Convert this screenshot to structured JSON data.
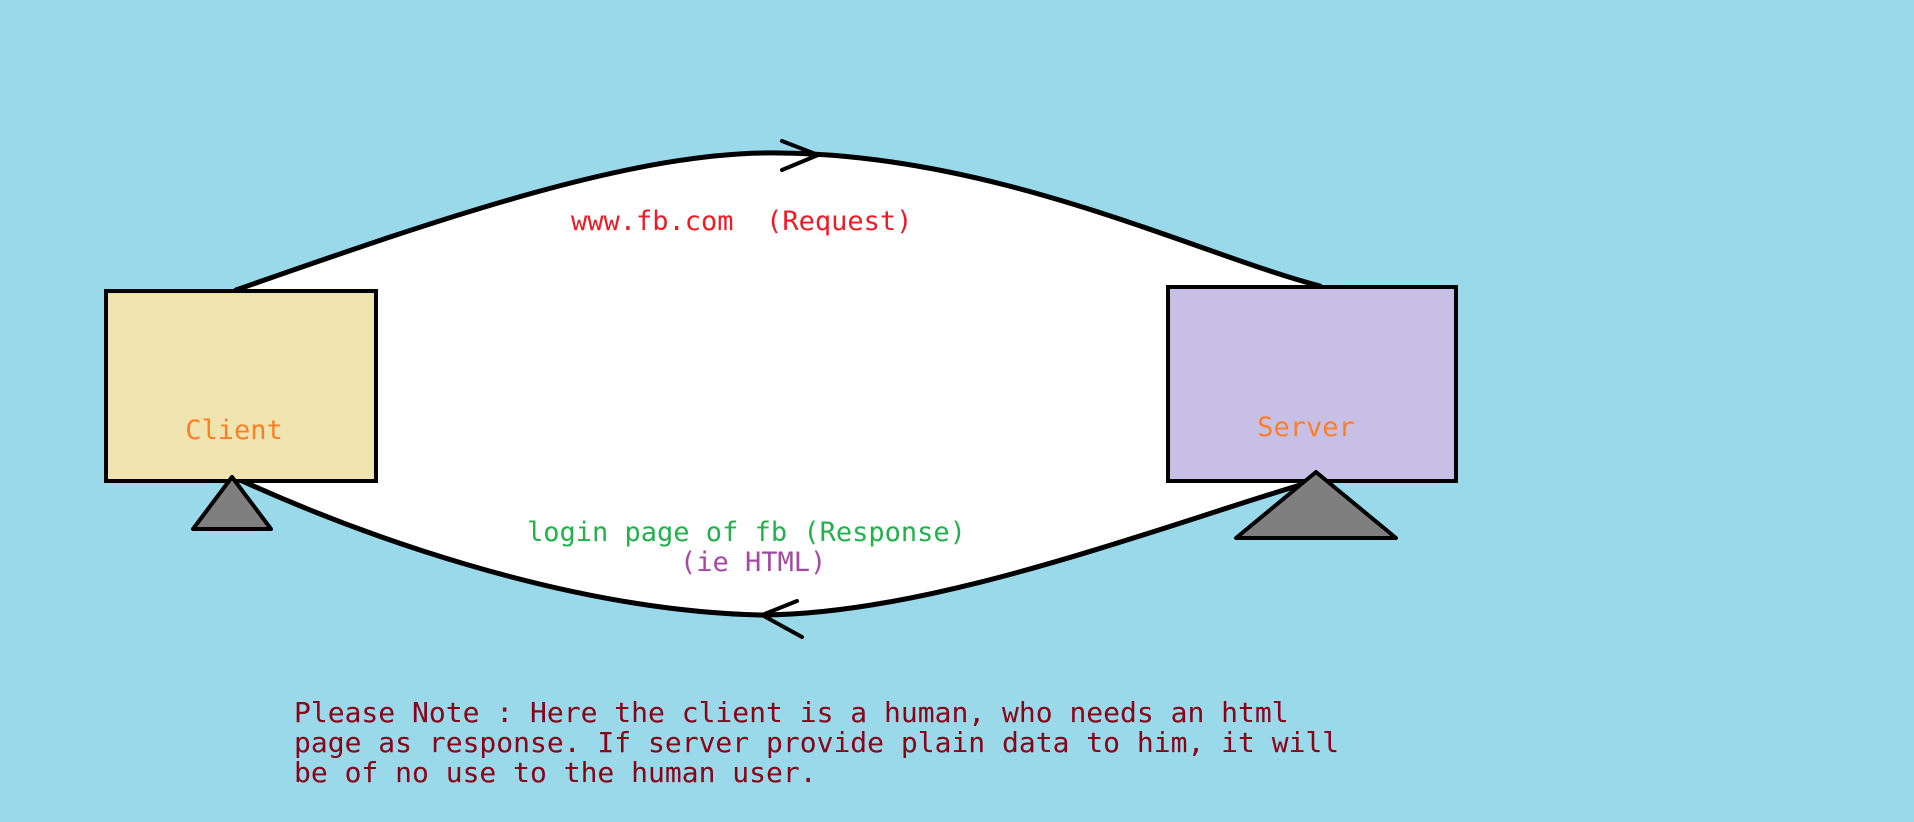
{
  "nodes": {
    "client": {
      "label": "Client",
      "fill": "#efe4b0"
    },
    "server": {
      "label": "Server",
      "fill": "#c8bfe7"
    }
  },
  "edges": {
    "request": {
      "label": "www.fb.com  (Request)"
    },
    "response": {
      "label": "login page of fb (Response)",
      "sublabel": "(ie HTML)"
    }
  },
  "note": {
    "text": "Please Note :  Here the client is a human, who needs an html\npage as response. If server provide plain data to him, it will\nbe of no use to the human user."
  },
  "colors": {
    "background": "#99d9ea",
    "ellipse_fill": "#ffffff",
    "outline": "#000000",
    "node_label": "#ff7f27",
    "request_label": "#ed1c24",
    "response_label": "#22b14c",
    "sublabel": "#a349a4",
    "note": "#880015",
    "stand": "#7f7f7f"
  }
}
